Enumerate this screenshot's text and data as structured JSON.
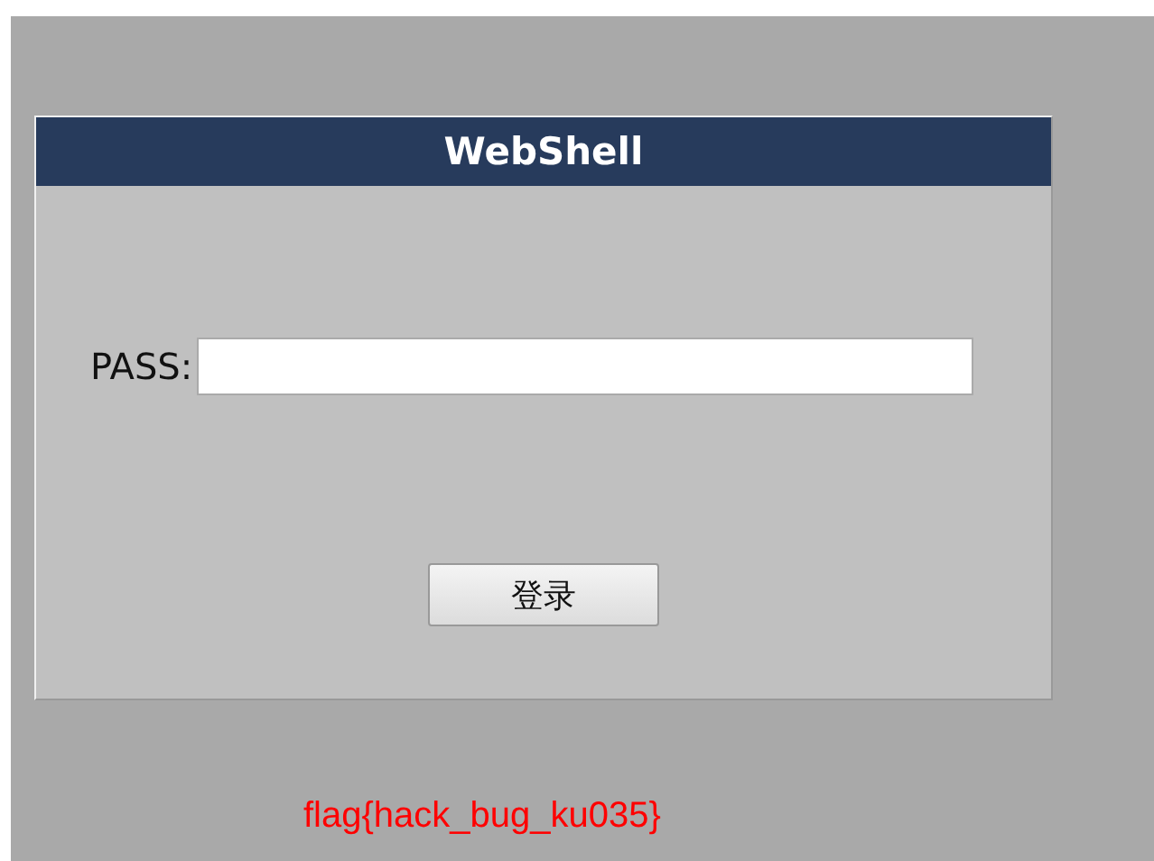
{
  "panel": {
    "title": "WebShell"
  },
  "password": {
    "label": "PASS:"
  },
  "login_button": {
    "label": "登录"
  },
  "flag": "flag{hack_bug_ku035}"
}
